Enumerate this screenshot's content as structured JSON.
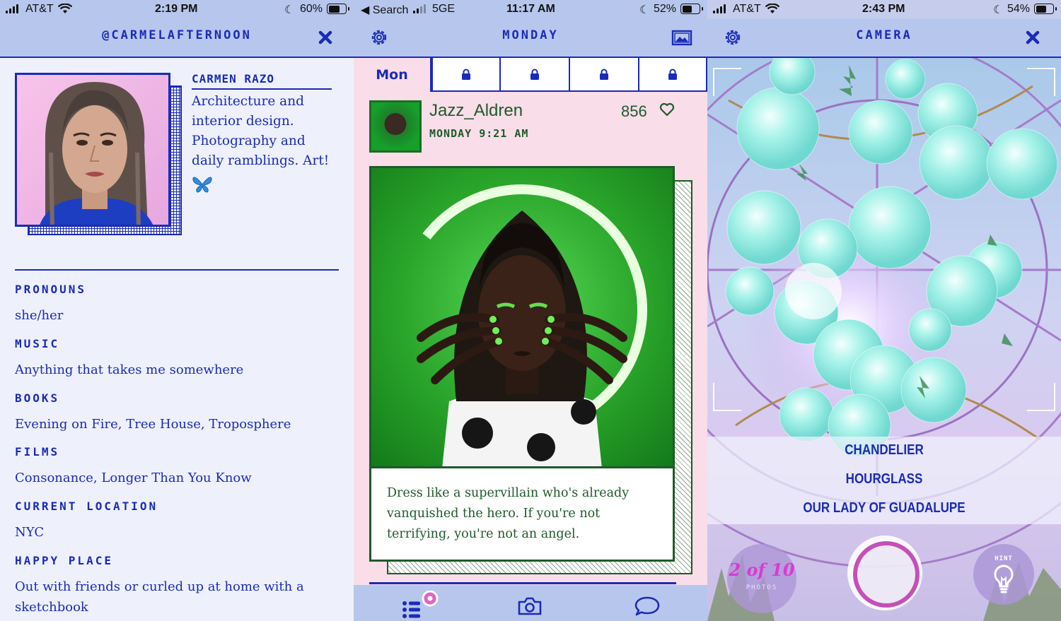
{
  "panel1": {
    "status": {
      "carrier": "AT&T",
      "time": "2:19 PM",
      "battery": "60%"
    },
    "nav": {
      "title": "@CARMELAFTERNOON"
    },
    "profile": {
      "name": "CARMEN RAZO",
      "bio": "Architecture and interior design. Photography and daily ramblings. Art!"
    },
    "fields": [
      {
        "label": "PRONOUNS",
        "value": "she/her"
      },
      {
        "label": "MUSIC",
        "value": "Anything that takes me somewhere"
      },
      {
        "label": "BOOKS",
        "value": "Evening on Fire, Tree House, Troposphere"
      },
      {
        "label": "FILMS",
        "value": "Consonance, Longer Than You Know"
      },
      {
        "label": "CURRENT LOCATION",
        "value": "NYC"
      },
      {
        "label": "HAPPY PLACE",
        "value": "Out with friends or curled up at home with a sketchbook"
      }
    ]
  },
  "panel2": {
    "status": {
      "back": "◀ Search",
      "network": "5GE",
      "time": "11:17 AM",
      "battery": "52%"
    },
    "nav": {
      "title": "MONDAY"
    },
    "tabs": {
      "active": "Mon"
    },
    "post": {
      "username": "Jazz_Aldren",
      "timestamp": "MONDAY 9:21 AM",
      "likes": "856",
      "caption": "Dress like a supervillain who's already vanquished the hero. If you're not terrifying, you're not an angel."
    }
  },
  "panel3": {
    "status": {
      "carrier": "AT&T",
      "time": "2:43 PM",
      "battery": "54%"
    },
    "nav": {
      "title": "CAMERA"
    },
    "options": [
      "CHANDELIER",
      "HOURGLASS",
      "OUR LADY OF GUADALUPE"
    ],
    "counter": {
      "text": "2 of 10",
      "label": "PHOTOS"
    },
    "hint_label": "HINT"
  }
}
